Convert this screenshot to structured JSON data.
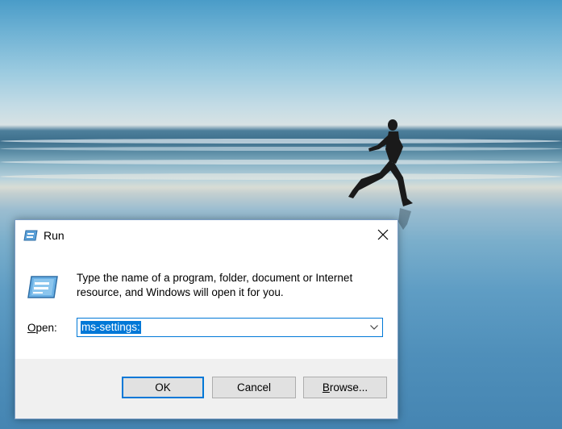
{
  "dialog": {
    "title": "Run",
    "description": "Type the name of a program, folder, document or Internet resource, and Windows will open it for you.",
    "open_label_accel": "O",
    "open_label_rest": "pen:",
    "open_value": "ms-settings:",
    "buttons": {
      "ok": "OK",
      "cancel": "Cancel",
      "browse_accel": "B",
      "browse_rest": "rowse..."
    }
  },
  "colors": {
    "accent": "#0078d7",
    "footer_bg": "#f0f0f0",
    "button_bg": "#e1e1e1"
  },
  "icons": [
    "run-icon",
    "close-icon",
    "chevron-down-icon"
  ]
}
